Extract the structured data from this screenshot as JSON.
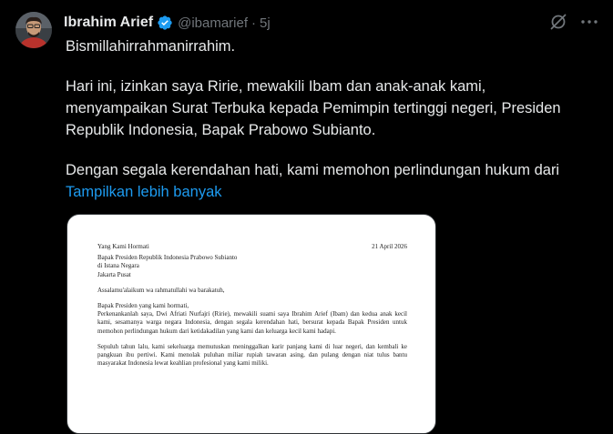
{
  "author": {
    "name": "Ibrahim Arief",
    "handle": "@ibamarief",
    "separator": "·",
    "time": "5j"
  },
  "icons": {
    "verified": "verified-badge-icon",
    "grok": "grok-icon",
    "more": "more-options-icon"
  },
  "post": {
    "line1": "Bismillahirrahmanirrahim.",
    "para2": [
      "Hari ini, izinkan saya Ririe, mewakili Ibam dan anak-anak kami,",
      "menyampaikan Surat Terbuka kepada Pemimpin tertinggi negeri, Presiden",
      "Republik Indonesia, Bapak Prabowo Subianto."
    ],
    "para3": "Dengan segala kerendahan hati, kami memohon perlindungan hukum dari",
    "show_more": "Tampilkan lebih banyak"
  },
  "letter": {
    "salutation_header": "Yang Kami Hormati",
    "date": "21 April 2026",
    "addressee": [
      "Bapak Presiden Republik Indonesia Prabowo Subianto",
      "di Istana Negara",
      "Jakarta Pusat"
    ],
    "greeting": "Assalamu'alaikum wa rahmatullahi wa barakatuh,",
    "opening": "Bapak Presiden yang kami hormati,",
    "p1": "Perkenankanlah saya, Dwi Afriati Nurfajri (Ririe), mewakili suami saya Ibrahim Arief (Ibam) dan kedua anak kecil kami, sesamanya warga negara Indonesia, dengan segala kerendahan hati, bersurat kepada Bapak Presiden untuk memohon perlindungan hukum dari ketidakadilan yang kami dan keluarga kecil kami hadapi.",
    "p2": "Sepuluh tahun lalu, kami sekeluarga memutuskan meninggalkan karir panjang kami di luar negeri, dan kembali ke pangkuan ibu pertiwi. Kami menolak puluhan miliar rupiah tawaran asing, dan pulang dengan niat tulus bantu masyarakat Indonesia lewat keahlian profesional yang kami miliki."
  },
  "colors": {
    "background": "#000000",
    "text": "#e7e9ea",
    "muted": "#71767b",
    "link": "#1d9bf0",
    "verified": "#1d9bf0"
  }
}
